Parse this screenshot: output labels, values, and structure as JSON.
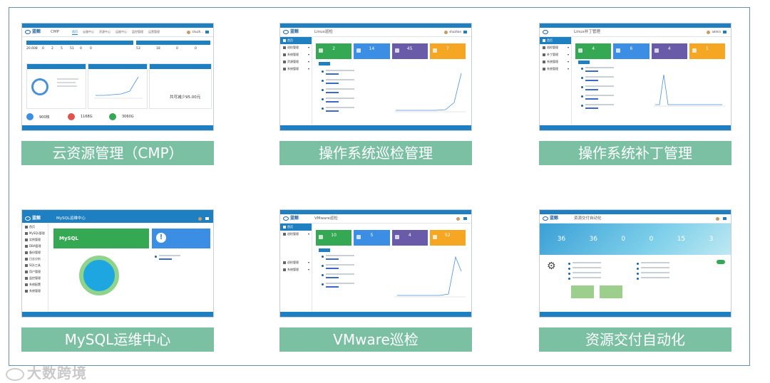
{
  "labels": {
    "cmp": "云资源管理（CMP）",
    "os_inspection": "操作系统巡检管理",
    "os_patch": "操作系统补丁管理",
    "mysql": "MySQL运维中心",
    "vmware": "VMware巡检",
    "delivery": "资源交付自动化"
  },
  "watermark": "大数跨境",
  "colors": {
    "label_bg": "#7cc0a4",
    "brand_blue": "#1e7fc1",
    "green": "#34a853",
    "blue": "#3b8ee3",
    "purple": "#6a5ba8",
    "orange": "#f5a623"
  },
  "cmp": {
    "logo": "蓝鲸",
    "app": "CMP",
    "tabs": [
      "首页",
      "云服中心",
      "资源中心",
      "运维中心",
      "监控管理",
      "运营管理"
    ],
    "table_row": [
      "20.608",
      "0",
      "2",
      "5",
      "51",
      "0",
      "0",
      "53",
      "18",
      "0",
      "0"
    ],
    "stat_totals": [
      "900核",
      "1168G",
      "3060G"
    ],
    "summary": "共可减少95.00元"
  },
  "linux": {
    "logo": "蓝鲸",
    "title": "Linux巡检",
    "user": "shuzhan",
    "menu": [
      "首页",
      "巡检管理",
      "系统管理",
      "资源管理",
      "系统管理"
    ],
    "tiles": [
      "2",
      "14",
      "45",
      "7"
    ]
  },
  "patch": {
    "title": "Linux补丁管理",
    "user": "admin",
    "menu": [
      "首页",
      "巡检管理",
      "补丁管理",
      "系统管理",
      "系统管理"
    ],
    "tiles": [
      "4",
      "6",
      "4",
      "1"
    ]
  },
  "mysql": {
    "logo": "蓝鲸",
    "title": "MySQL运维中心",
    "badge": "MySQL",
    "menu": [
      "首页",
      "MySQL管理",
      "实例管理",
      "DBA管理",
      "备份管理",
      "日志分析",
      "SQL工具",
      "用户管理",
      "监控管理",
      "系统配置",
      "系统管理"
    ]
  },
  "vmware": {
    "logo": "蓝鲸",
    "title": "VMware巡检",
    "menu": [
      "首页",
      "巡检管理",
      "巡检管理",
      "系统管理"
    ],
    "tiles": [
      "10",
      "5",
      "4",
      "52"
    ]
  },
  "delivery": {
    "logo": "蓝鲸",
    "title": "资源交付自动化",
    "banner": [
      "36",
      "36",
      "0",
      "0",
      "15",
      "3"
    ]
  }
}
